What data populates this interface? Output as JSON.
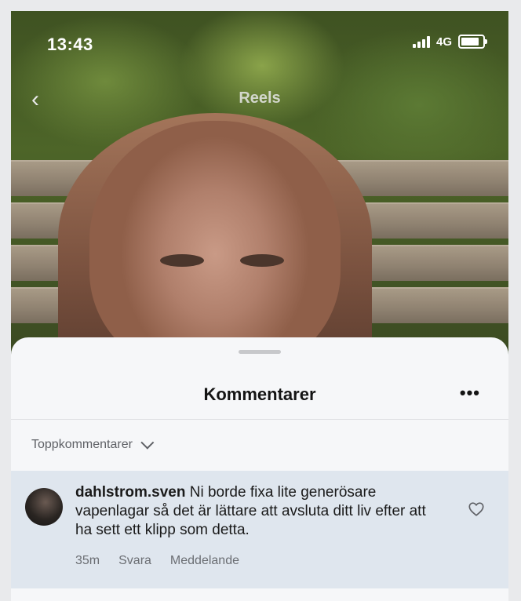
{
  "status_bar": {
    "time": "13:43",
    "network": "4G"
  },
  "header": {
    "title": "Reels"
  },
  "sheet": {
    "title": "Kommentarer",
    "sort_label": "Toppkommentarer"
  },
  "comment": {
    "username": "dahlstrom.sven",
    "text": "Ni borde fixa lite generösare vapenlagar så det är lättare att avsluta ditt liv efter att ha sett ett klipp som detta.",
    "time": "35m",
    "reply_label": "Svara",
    "message_label": "Meddelande"
  },
  "icons": {
    "back": "chevron-left-icon",
    "more": "more-horizontal-icon",
    "sort": "chevron-down-icon",
    "like": "heart-icon"
  }
}
